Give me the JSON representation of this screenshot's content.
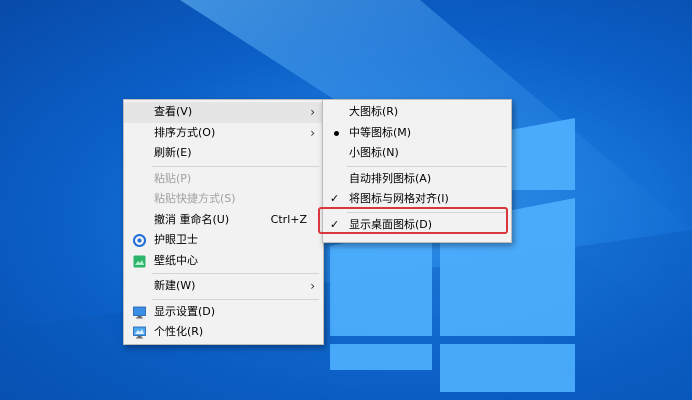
{
  "context_menu": {
    "items": [
      {
        "label": "查看(V)"
      },
      {
        "label": "排序方式(O)"
      },
      {
        "label": "刷新(E)"
      },
      {
        "label": "粘贴(P)"
      },
      {
        "label": "粘贴快捷方式(S)"
      },
      {
        "label": "撤消 重命名(U)",
        "shortcut": "Ctrl+Z"
      },
      {
        "label": "护眼卫士",
        "icon": "eye-guard-icon"
      },
      {
        "label": "壁纸中心",
        "icon": "wallpaper-center-icon"
      },
      {
        "label": "新建(W)"
      },
      {
        "label": "显示设置(D)",
        "icon": "display-settings-icon"
      },
      {
        "label": "个性化(R)",
        "icon": "personalize-icon"
      }
    ]
  },
  "view_submenu": {
    "items": [
      {
        "label": "大图标(R)"
      },
      {
        "label": "中等图标(M)"
      },
      {
        "label": "小图标(N)"
      },
      {
        "label": "自动排列图标(A)"
      },
      {
        "label": "将图标与网格对齐(I)"
      },
      {
        "label": "显示桌面图标(D)"
      }
    ]
  },
  "colors": {
    "desktop_blue": "#0b5fc7",
    "highlight_red": "#d9363e",
    "menu_bg": "#f2f2f2"
  }
}
